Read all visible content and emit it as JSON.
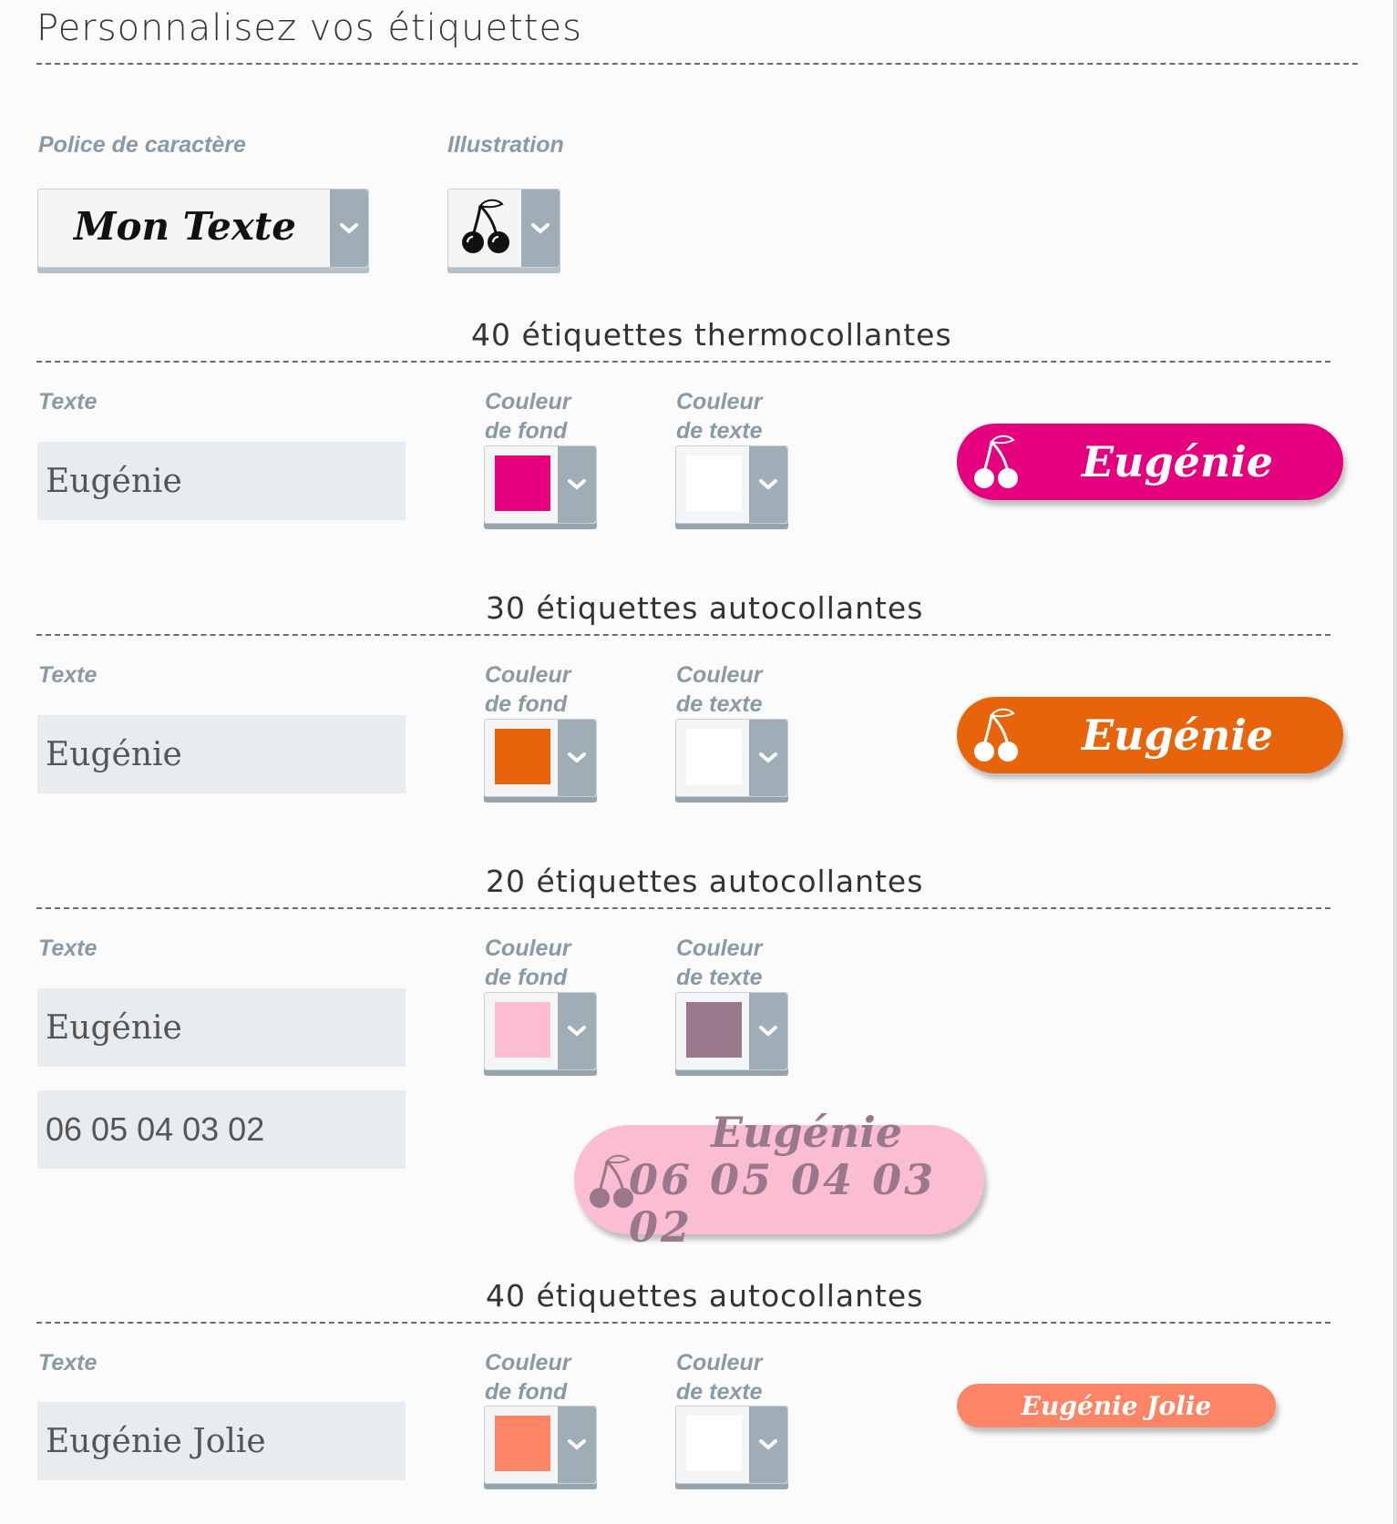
{
  "page": {
    "title": "Personnalisez vos étiquettes"
  },
  "font": {
    "label": "Police de caractère",
    "value": "Mon Texte"
  },
  "illustration": {
    "label": "Illustration",
    "icon": "cherry-icon"
  },
  "common": {
    "texte_label": "Texte",
    "fond_label_line1": "Couleur",
    "fond_label_line2": "de fond",
    "texte_color_label_line1": "Couleur",
    "texte_color_label_line2": "de texte"
  },
  "sections": [
    {
      "title": "40 étiquettes thermocollantes",
      "text": "Eugénie",
      "bg_color": "#e5007e",
      "text_color": "#ffffff",
      "preview_text": "Eugénie"
    },
    {
      "title": "30 étiquettes autocollantes",
      "text": "Eugénie",
      "bg_color": "#e8640b",
      "text_color": "#ffffff",
      "preview_text": "Eugénie"
    },
    {
      "title": "20 étiquettes autocollantes",
      "text": "Eugénie",
      "phone": "06 05 04 03 02",
      "bg_color": "#fbbdd2",
      "text_color": "#98788a",
      "preview_text": "Eugénie",
      "preview_phone": "06 05 04 03 02"
    },
    {
      "title": "40 étiquettes autocollantes",
      "text": "Eugénie Jolie",
      "bg_color": "#fd8566",
      "text_color": "#ffffff",
      "preview_text": "Eugénie Jolie"
    }
  ]
}
